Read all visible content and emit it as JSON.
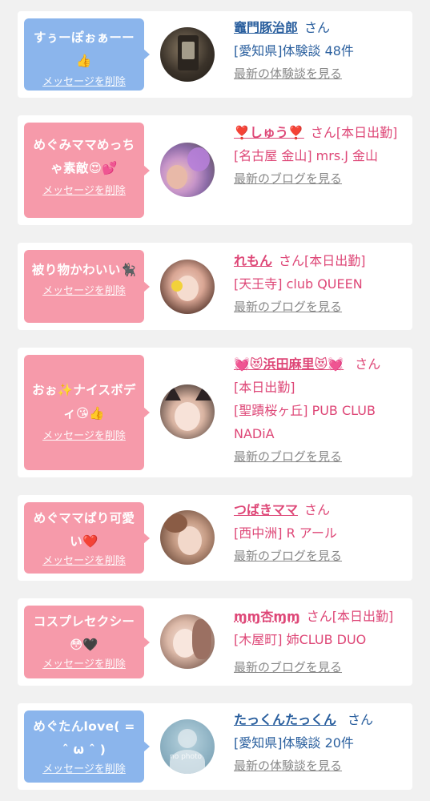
{
  "cards": [
    {
      "message": "すぅーぽぉぁーー👍",
      "delete_label": "メッセージを削除",
      "name": "竈門豚治郎",
      "suffix": "さん",
      "detail": "[愛知県]体験談 48件",
      "link": "最新の体験談を見る",
      "theme": "blue"
    },
    {
      "message": "めぐみママめっちゃ素敵😍💕",
      "delete_label": "メッセージを削除",
      "name": "❣️しゅう❣️",
      "suffix": "さん[本日出勤]",
      "detail": "[名古屋 金山] mrs.J 金山",
      "link": "最新のブログを見る",
      "theme": "pink"
    },
    {
      "message": "被り物かわいい🐈‍⬛",
      "delete_label": "メッセージを削除",
      "name": "れもん",
      "suffix": "さん[本日出勤]",
      "detail": "[天王寺] club QUEEN",
      "link": "最新のブログを見る",
      "theme": "pink"
    },
    {
      "message": "おぉ✨ナイスボディ😘👍",
      "delete_label": "メッセージを削除",
      "name": "💓😻浜田麻里😻💓",
      "suffix": "さん",
      "detail": "[本日出勤]",
      "detail2": "[聖蹟桜ヶ丘] PUB CLUB NADiA",
      "link": "最新のブログを見る",
      "theme": "pink"
    },
    {
      "message": "めぐママぱり可愛い❤️",
      "delete_label": "メッセージを削除",
      "name": "つばきママ",
      "suffix": "さん",
      "detail": "[西中洲] R アール",
      "link": "最新のブログを見る",
      "theme": "pink"
    },
    {
      "message": "コスプレセクシー😳🖤",
      "delete_label": "メッセージを削除",
      "name": "ɱɱ杏ɱɱ",
      "suffix": "さん[本日出勤]",
      "detail": "[木屋町] 姉CLUB DUO",
      "link": "最新のブログを見る",
      "theme": "pink"
    },
    {
      "message": "めぐたんlove( = ˆ ω ˆ )",
      "delete_label": "メッセージを削除",
      "name": "たっくんたっくん",
      "suffix": "さん",
      "detail": "[愛知県]体験談 20件",
      "link": "最新の体験談を見る",
      "theme": "blue",
      "avatar_text": "no photo"
    }
  ]
}
